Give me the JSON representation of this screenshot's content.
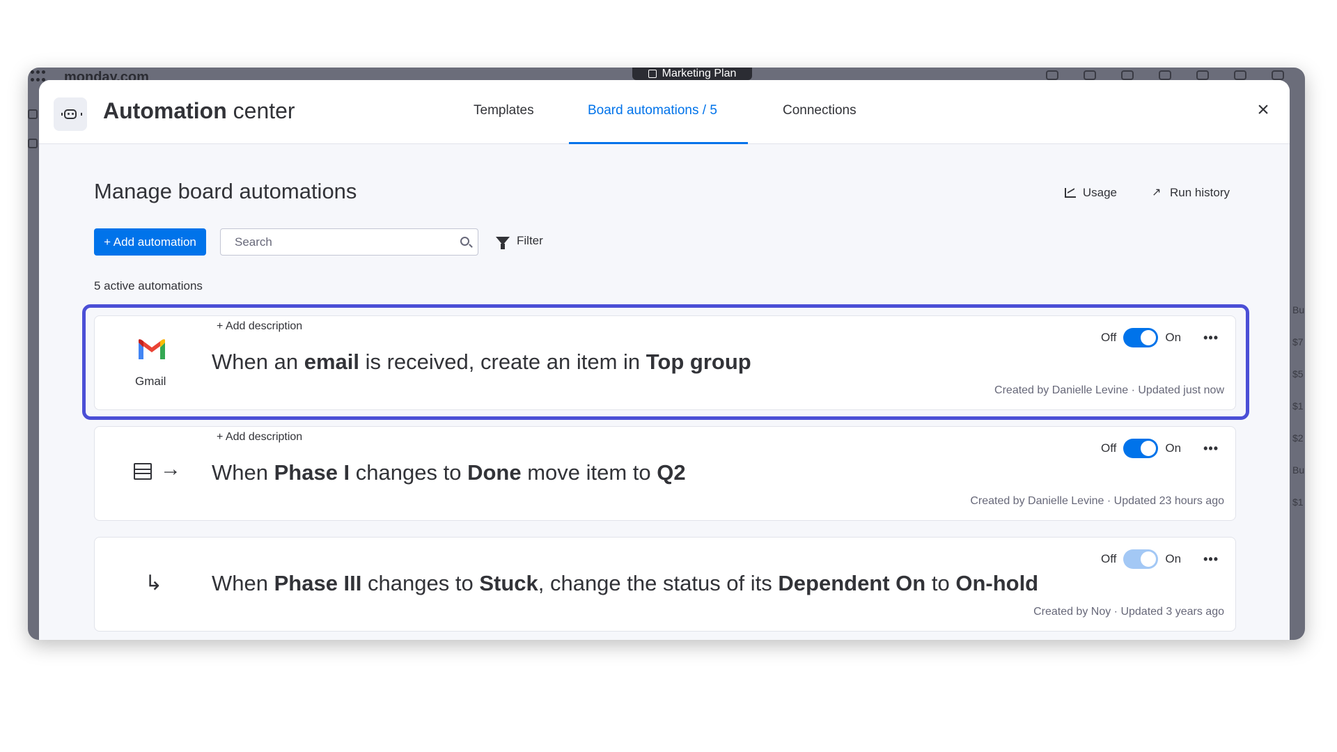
{
  "app": {
    "brand": "monday.com",
    "board_tag": "Marketing Plan",
    "right_column": [
      "Bu",
      "$7",
      "$5",
      "$1",
      "$2",
      "Bu",
      "$1"
    ]
  },
  "header": {
    "title_bold": "Automation",
    "title_rest": " center",
    "tabs": [
      {
        "label": "Templates",
        "active": false
      },
      {
        "label": "Board automations / 5",
        "active": true
      },
      {
        "label": "Connections",
        "active": false
      }
    ],
    "close_label": "×"
  },
  "main": {
    "section_title": "Manage board automations",
    "usage_label": "Usage",
    "run_history_label": "Run history",
    "add_automation_label": "+ Add automation",
    "search_placeholder": "Search",
    "filter_label": "Filter",
    "active_count": "5 active automations"
  },
  "toggle_labels": {
    "off": "Off",
    "on": "On"
  },
  "automations": [
    {
      "add_description": "+ Add description",
      "icon": "gmail-icon",
      "icon_label": "Gmail",
      "recipe": [
        {
          "t": "When an ",
          "b": false
        },
        {
          "t": "email",
          "b": true
        },
        {
          "t": " is received, create an item in ",
          "b": false
        },
        {
          "t": "Top group",
          "b": true
        }
      ],
      "enabled": true,
      "meta": "Created by Danielle Levine · Updated just now"
    },
    {
      "add_description": "+ Add description",
      "icon": "table-arrow-icon",
      "recipe": [
        {
          "t": "When ",
          "b": false
        },
        {
          "t": "Phase I",
          "b": true
        },
        {
          "t": " changes to ",
          "b": false
        },
        {
          "t": "Done",
          "b": true
        },
        {
          "t": " move item to ",
          "b": false
        },
        {
          "t": "Q2",
          "b": true
        }
      ],
      "enabled": true,
      "meta": "Created by Danielle Levine · Updated 23 hours ago"
    },
    {
      "add_description": "",
      "icon": "branch-arrow-icon",
      "recipe": [
        {
          "t": "When ",
          "b": false
        },
        {
          "t": "Phase III",
          "b": true
        },
        {
          "t": " changes to ",
          "b": false
        },
        {
          "t": "Stuck",
          "b": true
        },
        {
          "t": ", change the status of its ",
          "b": false
        },
        {
          "t": "Dependent On",
          "b": true
        },
        {
          "t": " to ",
          "b": false
        },
        {
          "t": "On-hold",
          "b": true
        }
      ],
      "enabled": true,
      "meta": "Created by Noy · Updated 3 years ago"
    }
  ],
  "colors": {
    "accent": "#0073ea",
    "highlight": "#4b4fd6",
    "gmail_red": "#ea4335",
    "gmail_blue": "#4285f4",
    "gmail_green": "#34a853",
    "gmail_yellow": "#fbbc04"
  }
}
